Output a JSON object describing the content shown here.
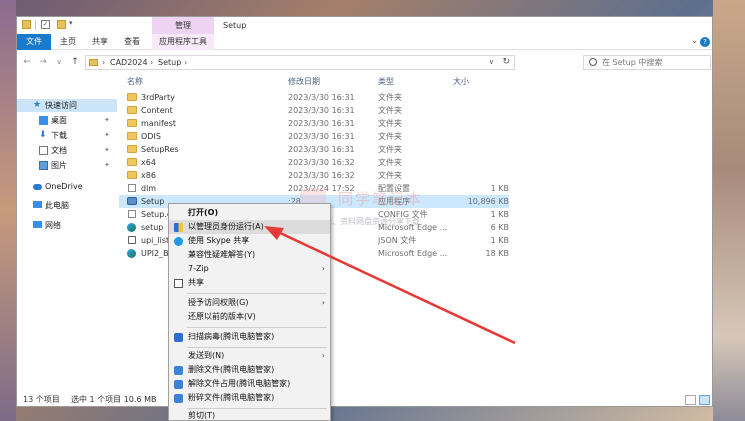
{
  "window": {
    "title": "Setup",
    "context_tab_header": "管理"
  },
  "ribbon": {
    "tabs": [
      "文件",
      "主页",
      "共享",
      "查看",
      "应用程序工具"
    ]
  },
  "address": {
    "segments": [
      "CAD2024",
      "Setup"
    ],
    "search_placeholder": "在 Setup 中搜索"
  },
  "nav_pane": {
    "items": [
      {
        "label": "快速访问",
        "icon": "star-icon",
        "pinned": false
      },
      {
        "label": "桌面",
        "icon": "desktop-icon",
        "pinned": true
      },
      {
        "label": "下载",
        "icon": "download-icon",
        "pinned": true
      },
      {
        "label": "文档",
        "icon": "document-icon",
        "pinned": true
      },
      {
        "label": "图片",
        "icon": "picture-icon",
        "pinned": true
      },
      {
        "label": "OneDrive",
        "icon": "cloud-icon",
        "pinned": false
      },
      {
        "label": "此电脑",
        "icon": "computer-icon",
        "pinned": false
      },
      {
        "label": "网络",
        "icon": "network-icon",
        "pinned": false
      }
    ]
  },
  "file_list": {
    "columns": [
      "名称",
      "修改日期",
      "类型",
      "大小"
    ],
    "rows": [
      {
        "name": "3rdParty",
        "date": "2023/3/30 16:31",
        "type": "文件夹",
        "size": "",
        "icon": "folder"
      },
      {
        "name": "Content",
        "date": "2023/3/30 16:31",
        "type": "文件夹",
        "size": "",
        "icon": "folder"
      },
      {
        "name": "manifest",
        "date": "2023/3/30 16:31",
        "type": "文件夹",
        "size": "",
        "icon": "folder"
      },
      {
        "name": "ODIS",
        "date": "2023/3/30 16:31",
        "type": "文件夹",
        "size": "",
        "icon": "folder"
      },
      {
        "name": "SetupRes",
        "date": "2023/3/30 16:31",
        "type": "文件夹",
        "size": "",
        "icon": "folder"
      },
      {
        "name": "x64",
        "date": "2023/3/30 16:32",
        "type": "文件夹",
        "size": "",
        "icon": "folder"
      },
      {
        "name": "x86",
        "date": "2023/3/30 16:32",
        "type": "文件夹",
        "size": "",
        "icon": "folder"
      },
      {
        "name": "dlm",
        "date": "2023/2/24 17:52",
        "type": "配置设置",
        "size": "1 KB",
        "icon": "doc"
      },
      {
        "name": "Setup",
        "date": ":28",
        "type": "应用程序",
        "size": "10,896 KB",
        "icon": "setup"
      },
      {
        "name": "Setup.e",
        "date": ":26",
        "type": "CONFIG 文件",
        "size": "1 KB",
        "icon": "doc"
      },
      {
        "name": "setup",
        "date": "45",
        "type": "Microsoft Edge ...",
        "size": "6 KB",
        "icon": "edge"
      },
      {
        "name": "upi_list.",
        "date": "45",
        "type": "JSON 文件",
        "size": "1 KB",
        "icon": "json"
      },
      {
        "name": "UPI2_BC",
        "date": "45",
        "type": "Microsoft Edge ...",
        "size": "18 KB",
        "icon": "edge"
      }
    ]
  },
  "status": {
    "item_count": "13 个项目",
    "selected": "选中 1 个项目  10.6 MB"
  },
  "context_menu": {
    "items": [
      {
        "label": "打开(O)",
        "bold": true,
        "icon": "",
        "submenu": false
      },
      {
        "label": "以管理员身份运行(A)",
        "bold": false,
        "icon": "shield-icon",
        "submenu": false
      },
      {
        "label": "使用 Skype 共享",
        "bold": false,
        "icon": "skype-icon",
        "submenu": false
      },
      {
        "label": "兼容性疑难解答(Y)",
        "bold": false,
        "icon": "",
        "submenu": false
      },
      {
        "label": "7-Zip",
        "bold": false,
        "icon": "",
        "submenu": true
      },
      {
        "label": "共享",
        "bold": false,
        "icon": "share-icon",
        "submenu": false
      },
      {
        "label": "授予访问权限(G)",
        "bold": false,
        "icon": "",
        "submenu": true
      },
      {
        "label": "还原以前的版本(V)",
        "bold": false,
        "icon": "",
        "submenu": false
      },
      {
        "label": "扫描病毒(腾讯电脑管家)",
        "bold": false,
        "icon": "tencent-shield-icon",
        "submenu": false
      },
      {
        "label": "发送到(N)",
        "bold": false,
        "icon": "",
        "submenu": true
      },
      {
        "label": "删除文件(腾讯电脑管家)",
        "bold": false,
        "icon": "tencent-delete-icon",
        "submenu": false
      },
      {
        "label": "解除文件占用(腾讯电脑管家)",
        "bold": false,
        "icon": "tencent-unlock-icon",
        "submenu": false
      },
      {
        "label": "粉碎文件(腾讯电脑管家)",
        "bold": false,
        "icon": "tencent-shred-icon",
        "submenu": false
      },
      {
        "label": "剪切(T)",
        "bold": false,
        "icon": "",
        "submenu": false
      }
    ]
  },
  "watermark": {
    "title": "同学笔记本",
    "subtitle": "软件、资源、资料网盘资源分享下载"
  },
  "colors": {
    "accent": "#1979ca",
    "selected_row": "#cce8ff",
    "annotation_arrow": "#e53935"
  }
}
